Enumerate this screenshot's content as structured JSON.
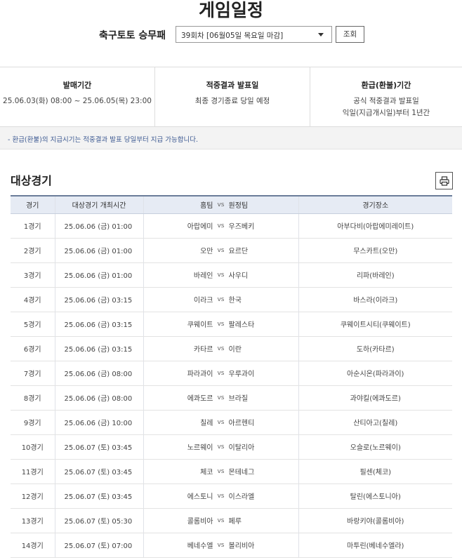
{
  "page_title": "게임일정",
  "selector": {
    "label": "축구토토 승무패",
    "selected_round": "39회차 [06월05일 목요일 마감]",
    "search_button": "조회"
  },
  "info": [
    {
      "title": "발매기간",
      "lines": [
        "25.06.03(화) 08:00 ~ 25.06.05(목) 23:00"
      ]
    },
    {
      "title": "적중결과 발표일",
      "lines": [
        "최종 경기종료 당일 예정"
      ]
    },
    {
      "title": "환급(환불)기간",
      "lines": [
        "공식 적중결과 발표일",
        "익일(지급개시일)부터 1년간"
      ]
    }
  ],
  "notice": "- 환급(환불)의 지급시기는 적중결과 발표 당일부터 지급 가능합니다.",
  "section_title": "대상경기",
  "table": {
    "headers": {
      "game": "경기",
      "time": "대상경기 개최시간",
      "teams": "홈팀",
      "vs": "vs",
      "away": "원정팀",
      "venue": "경기장소"
    },
    "rows": [
      {
        "game": "1경기",
        "time": "25.06.06 (금) 01:00",
        "home": "아랍에미",
        "vs": "vs",
        "away": "우즈베키",
        "venue": "아부다비(아랍에미레이트)"
      },
      {
        "game": "2경기",
        "time": "25.06.06 (금) 01:00",
        "home": "오만",
        "vs": "vs",
        "away": "요르단",
        "venue": "무스카트(오만)"
      },
      {
        "game": "3경기",
        "time": "25.06.06 (금) 01:00",
        "home": "바레인",
        "vs": "vs",
        "away": "사우디",
        "venue": "리파(바레인)"
      },
      {
        "game": "4경기",
        "time": "25.06.06 (금) 03:15",
        "home": "이라크",
        "vs": "vs",
        "away": "한국",
        "venue": "바스라(이라크)"
      },
      {
        "game": "5경기",
        "time": "25.06.06 (금) 03:15",
        "home": "쿠웨이트",
        "vs": "vs",
        "away": "팔레스타",
        "venue": "쿠웨이트시티(쿠웨이트)"
      },
      {
        "game": "6경기",
        "time": "25.06.06 (금) 03:15",
        "home": "카타르",
        "vs": "vs",
        "away": "이란",
        "venue": "도하(카타르)"
      },
      {
        "game": "7경기",
        "time": "25.06.06 (금) 08:00",
        "home": "파라과이",
        "vs": "vs",
        "away": "우루과이",
        "venue": "아순시온(파라과이)"
      },
      {
        "game": "8경기",
        "time": "25.06.06 (금) 08:00",
        "home": "에콰도르",
        "vs": "vs",
        "away": "브라질",
        "venue": "과야킬(에콰도르)"
      },
      {
        "game": "9경기",
        "time": "25.06.06 (금) 10:00",
        "home": "칠레",
        "vs": "vs",
        "away": "아르헨티",
        "venue": "산티아고(칠레)"
      },
      {
        "game": "10경기",
        "time": "25.06.07 (토) 03:45",
        "home": "노르웨이",
        "vs": "vs",
        "away": "이탈리아",
        "venue": "오슬로(노르웨이)"
      },
      {
        "game": "11경기",
        "time": "25.06.07 (토) 03:45",
        "home": "체코",
        "vs": "vs",
        "away": "몬테네그",
        "venue": "필센(체코)"
      },
      {
        "game": "12경기",
        "time": "25.06.07 (토) 03:45",
        "home": "에스토니",
        "vs": "vs",
        "away": "이스라엘",
        "venue": "탈린(에스토니아)"
      },
      {
        "game": "13경기",
        "time": "25.06.07 (토) 05:30",
        "home": "콜롬비아",
        "vs": "vs",
        "away": "페루",
        "venue": "바랑키야(콜롬비아)"
      },
      {
        "game": "14경기",
        "time": "25.06.07 (토) 07:00",
        "home": "베네수엘",
        "vs": "vs",
        "away": "볼리비아",
        "venue": "마투린(베네수엘라)"
      }
    ]
  },
  "icons": {
    "print": "print-icon",
    "dropdown": "chevron-down-icon"
  }
}
